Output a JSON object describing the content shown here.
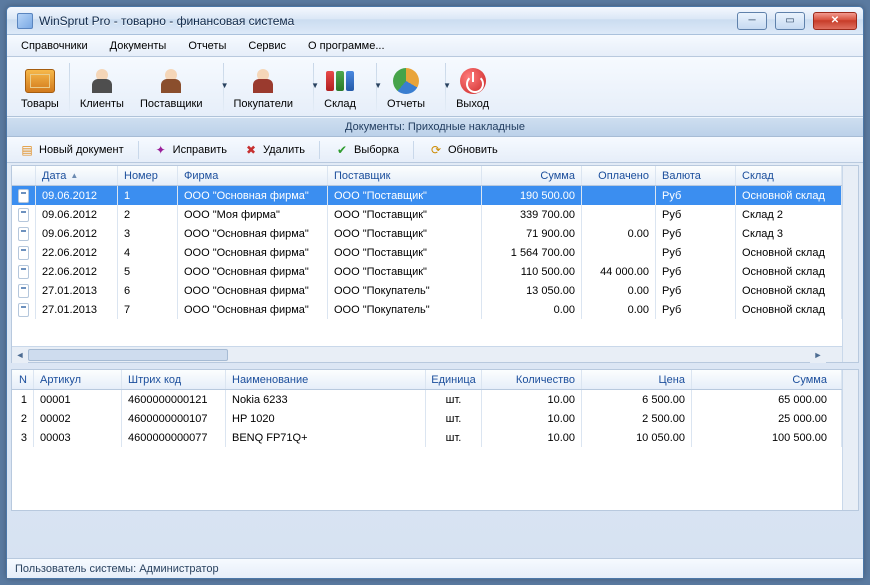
{
  "window": {
    "title": "WinSprut Pro - товарно - финансовая система"
  },
  "menu": [
    "Справочники",
    "Документы",
    "Отчеты",
    "Сервис",
    "О программе..."
  ],
  "toolbar": {
    "goods": "Товары",
    "clients": "Клиенты",
    "suppliers": "Поставщики",
    "buyers": "Покупатели",
    "warehouse": "Склад",
    "reports": "Отчеты",
    "exit": "Выход"
  },
  "header_strip": "Документы: Приходные накладные",
  "doc_toolbar": {
    "new": "Новый документ",
    "edit": "Исправить",
    "delete": "Удалить",
    "filter": "Выборка",
    "refresh": "Обновить"
  },
  "doc_grid": {
    "columns": [
      "",
      "Дата",
      "Номер",
      "Фирма",
      "Поставщик",
      "Сумма",
      "Оплачено",
      "Валюта",
      "Склад"
    ],
    "rows": [
      {
        "date": "09.06.2012",
        "num": "1",
        "firm": "ООО \"Основная фирма\"",
        "sup": "ООО \"Поставщик\"",
        "sum": "190 500.00",
        "paid": "",
        "cur": "Руб",
        "wh": "Основной склад",
        "selected": true
      },
      {
        "date": "09.06.2012",
        "num": "2",
        "firm": "ООО \"Моя фирма\"",
        "sup": "ООО \"Поставщик\"",
        "sum": "339 700.00",
        "paid": "",
        "cur": "Руб",
        "wh": "Склад 2"
      },
      {
        "date": "09.06.2012",
        "num": "3",
        "firm": "ООО \"Основная фирма\"",
        "sup": "ООО \"Поставщик\"",
        "sum": "71 900.00",
        "paid": "0.00",
        "cur": "Руб",
        "wh": "Склад 3"
      },
      {
        "date": "22.06.2012",
        "num": "4",
        "firm": "ООО \"Основная фирма\"",
        "sup": "ООО \"Поставщик\"",
        "sum": "1 564 700.00",
        "paid": "",
        "cur": "Руб",
        "wh": "Основной склад"
      },
      {
        "date": "22.06.2012",
        "num": "5",
        "firm": "ООО \"Основная фирма\"",
        "sup": "ООО \"Поставщик\"",
        "sum": "110 500.00",
        "paid": "44 000.00",
        "cur": "Руб",
        "wh": "Основной склад"
      },
      {
        "date": "27.01.2013",
        "num": "6",
        "firm": "ООО \"Основная фирма\"",
        "sup": "ООО \"Покупатель\"",
        "sum": "13 050.00",
        "paid": "0.00",
        "cur": "Руб",
        "wh": "Основной склад"
      },
      {
        "date": "27.01.2013",
        "num": "7",
        "firm": "ООО \"Основная фирма\"",
        "sup": "ООО \"Покупатель\"",
        "sum": "0.00",
        "paid": "0.00",
        "cur": "Руб",
        "wh": "Основной склад"
      }
    ]
  },
  "detail_grid": {
    "columns": [
      "N",
      "Артикул",
      "Штрих код",
      "Наименование",
      "Единица",
      "Количество",
      "Цена",
      "Сумма"
    ],
    "rows": [
      {
        "n": "1",
        "art": "00001",
        "bc": "4600000000121",
        "name": "Nokia 6233",
        "unit": "шт.",
        "qty": "10.00",
        "price": "6 500.00",
        "sum": "65 000.00"
      },
      {
        "n": "2",
        "art": "00002",
        "bc": "4600000000107",
        "name": "HP 1020",
        "unit": "шт.",
        "qty": "10.00",
        "price": "2 500.00",
        "sum": "25 000.00"
      },
      {
        "n": "3",
        "art": "00003",
        "bc": "4600000000077",
        "name": "BENQ FP71Q+",
        "unit": "шт.",
        "qty": "10.00",
        "price": "10 050.00",
        "sum": "100 500.00"
      }
    ]
  },
  "status": "Пользователь системы: Администратор"
}
